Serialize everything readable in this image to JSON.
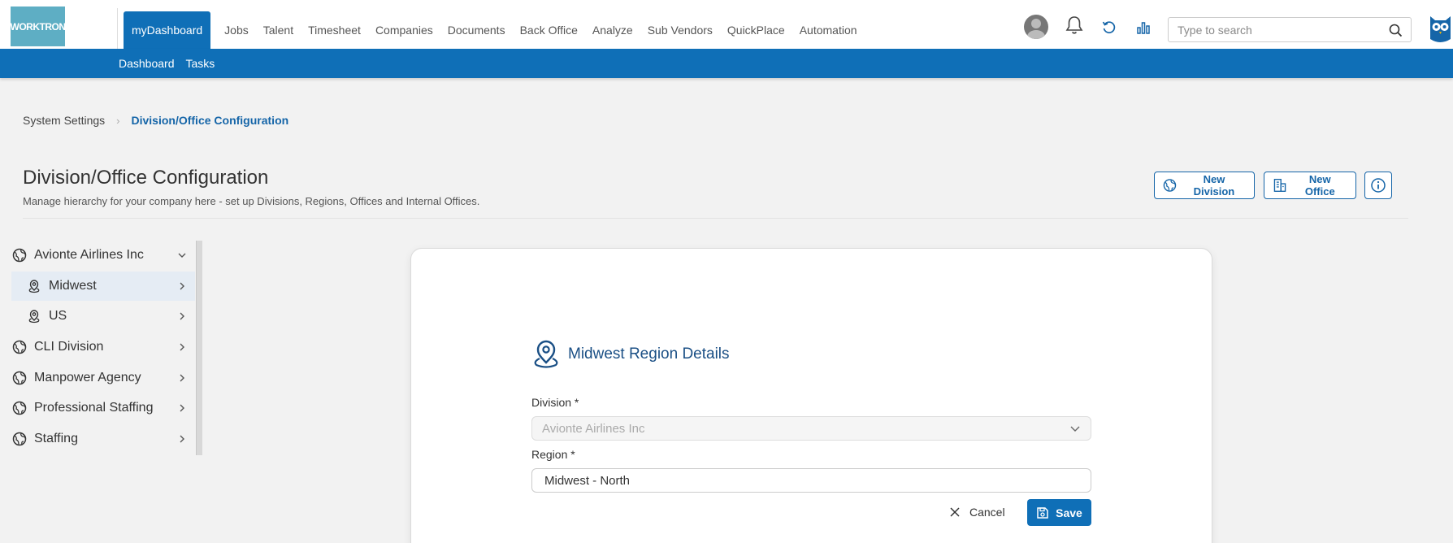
{
  "brand": {
    "logo_text": "WORKTRON"
  },
  "nav": {
    "items": [
      {
        "label": "myDashboard",
        "active": true
      },
      {
        "label": "Jobs"
      },
      {
        "label": "Talent"
      },
      {
        "label": "Timesheet"
      },
      {
        "label": "Companies"
      },
      {
        "label": "Documents"
      },
      {
        "label": "Back Office"
      },
      {
        "label": "Analyze"
      },
      {
        "label": "Sub Vendors"
      },
      {
        "label": "QuickPlace"
      },
      {
        "label": "Automation"
      }
    ]
  },
  "search": {
    "placeholder": "Type to search"
  },
  "icons": {
    "avatar": "user-avatar",
    "notifications": "bell-icon",
    "refresh": "refresh-icon",
    "analytics": "bar-chart-icon",
    "search": "search-icon",
    "help": "owl-icon"
  },
  "subnav": {
    "items": [
      {
        "label": "Dashboard"
      },
      {
        "label": "Tasks"
      }
    ]
  },
  "breadcrumb": {
    "parent": "System Settings",
    "current": "Division/Office Configuration"
  },
  "page": {
    "title": "Division/Office Configuration",
    "subtitle": "Manage hierarchy for your company here - set up Divisions, Regions, Offices and Internal Offices."
  },
  "header_actions": {
    "new_division": "New Division",
    "new_office": "New Office"
  },
  "tree": {
    "items": [
      {
        "label": "Avionte Airlines Inc",
        "type": "division",
        "expanded": true
      },
      {
        "label": "Midwest",
        "type": "region",
        "selected": true
      },
      {
        "label": "US",
        "type": "region"
      },
      {
        "label": "CLI Division",
        "type": "division"
      },
      {
        "label": "Manpower Agency",
        "type": "division"
      },
      {
        "label": "Professional Staffing",
        "type": "division"
      },
      {
        "label": "Staffing",
        "type": "division"
      }
    ]
  },
  "form": {
    "title": "Midwest Region Details",
    "division_label": "Division *",
    "division_value": "Avionte Airlines Inc",
    "region_label": "Region *",
    "region_value": "Midwest - North",
    "cancel_label": "Cancel",
    "save_label": "Save"
  },
  "colors": {
    "primary": "#0f6fb7",
    "logo_bg": "#5eaec4",
    "heading_blue": "#1a4f85"
  }
}
